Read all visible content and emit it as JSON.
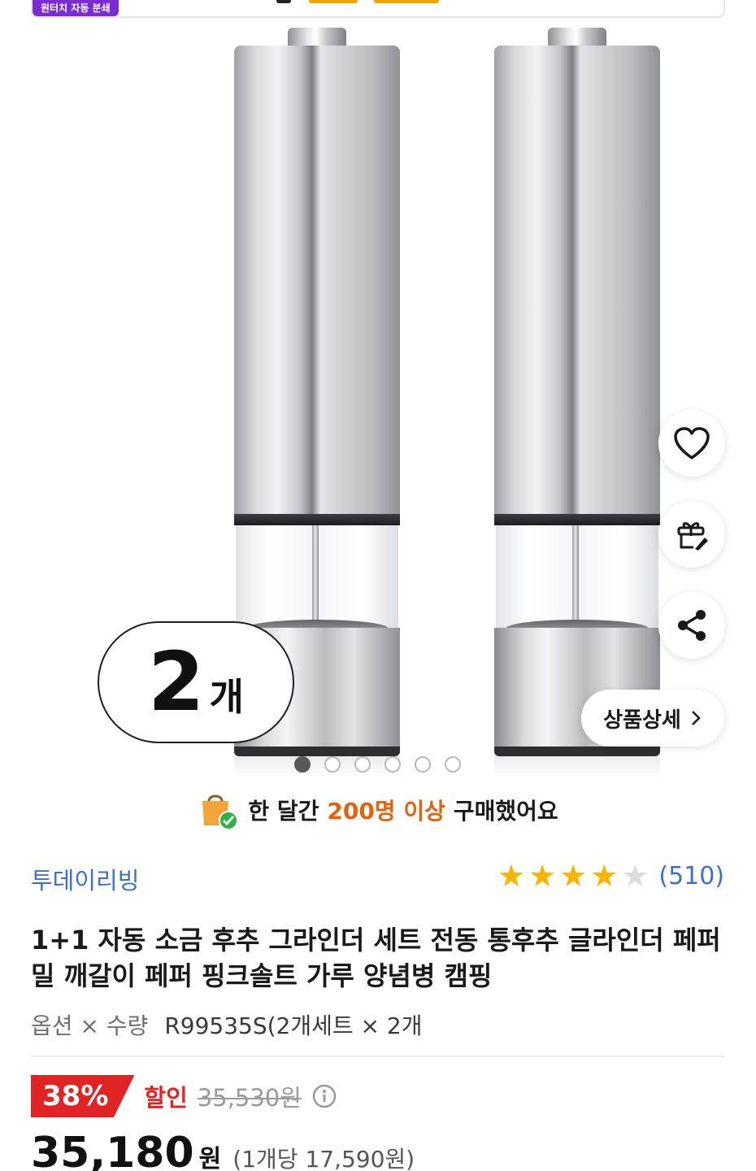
{
  "top_banner": {
    "badge": "원터치 자동 분쇄"
  },
  "product_image": {
    "quantity_number": "2",
    "quantity_unit": "개",
    "detail_button": "상품상세",
    "carousel_total": 6,
    "carousel_active": 1
  },
  "purchase": {
    "prefix": "한 달간",
    "highlight": "200명 이상",
    "suffix": "구매했어요"
  },
  "store": {
    "name": "투데이리빙"
  },
  "rating": {
    "stars": 4,
    "max": 5,
    "count": "(510)"
  },
  "product": {
    "title": "1+1 자동 소금 후추 그라인더 세트 전동 통후추 글라인더 페퍼밀 깨갈이 페퍼 핑크솔트 가루 양념병 캠핑",
    "option_label": "옵션 × 수량",
    "option_value": "R99535S(2개세트 × 2개"
  },
  "price": {
    "discount_percent": "38%",
    "discount_label": "할인",
    "original": "35,530원",
    "final": "35,180",
    "final_unit": "원",
    "per_unit": "(1개당 17,590원)"
  },
  "colors": {
    "accent_red": "#e02323",
    "link_blue": "#3b6fd6",
    "star": "#f8b400",
    "highlight_orange": "#e8610a",
    "badge_purple": "#7b2bd6"
  }
}
